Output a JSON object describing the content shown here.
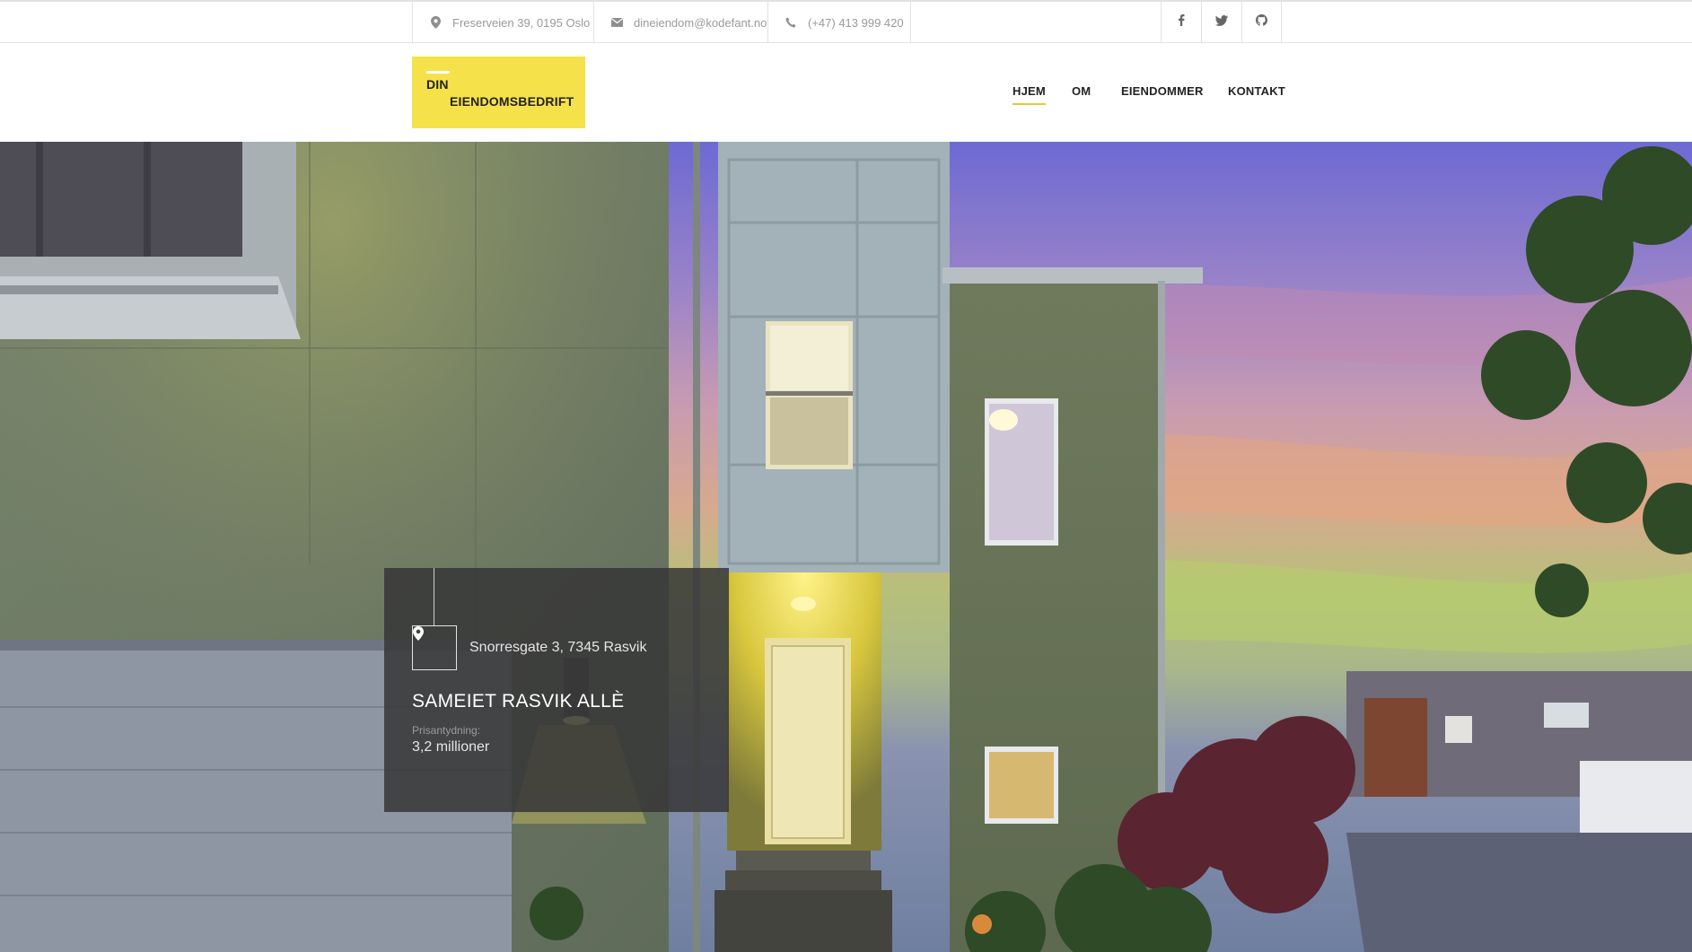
{
  "topbar": {
    "address": "Freserveien 39, 0195 Oslo",
    "email": "dineiendom@kodefant.no",
    "phone": "(+47) 413 999 420",
    "icons": {
      "address": "map-pin-icon",
      "email": "envelope-icon",
      "phone": "phone-icon",
      "social": [
        "facebook-icon",
        "twitter-icon",
        "github-icon"
      ]
    }
  },
  "logo": {
    "line1": "DIN",
    "line2": "EIENDOMSBEDRIFT",
    "background": "#f5e14a"
  },
  "nav": {
    "items": [
      {
        "label": "HJEM",
        "active": true
      },
      {
        "label": "OM",
        "active": false
      },
      {
        "label": "EIENDOMMER",
        "active": false
      },
      {
        "label": "KONTAKT",
        "active": false
      }
    ],
    "accent": "#e8c837"
  },
  "hero": {
    "card": {
      "address": "Snorresgate 3, 7345 Rasvik",
      "title": "SAMEIET RASVIK ALLÈ",
      "price_label": "Prisantydning:",
      "price": "3,2 millioner",
      "icon": "map-pin-icon"
    }
  }
}
